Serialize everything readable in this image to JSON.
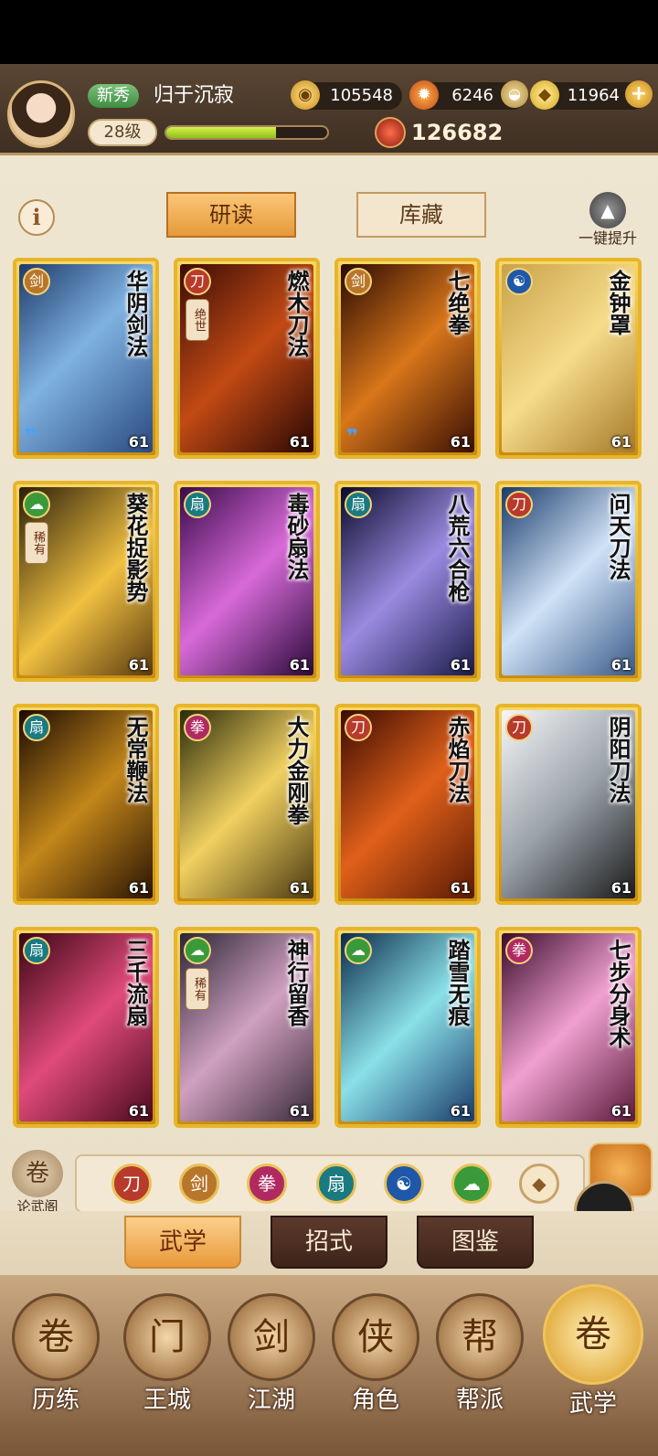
{
  "player": {
    "rank_badge": "新秀",
    "name": "归于沉寂",
    "level": "28级",
    "exp_fraction": 0.68,
    "power": "126682"
  },
  "resources": {
    "coins": "105548",
    "energy": "6246",
    "ingots": "11964"
  },
  "tabs": {
    "study": "研读",
    "storage": "库藏"
  },
  "upgrade_all_label": "一键提升",
  "cards": [
    {
      "title": "华阴剑法",
      "school": "sword",
      "level": "61",
      "tag": ""
    },
    {
      "title": "燃木刀法",
      "school": "blade",
      "level": "61",
      "tag": "绝世"
    },
    {
      "title": "七绝拳",
      "school": "sword",
      "level": "61",
      "tag": ""
    },
    {
      "title": "金钟罩",
      "school": "internal",
      "level": "61",
      "tag": ""
    },
    {
      "title": "葵花捉影势",
      "school": "light",
      "level": "61",
      "tag": "稀有"
    },
    {
      "title": "毒砂扇法",
      "school": "fan",
      "level": "61",
      "tag": ""
    },
    {
      "title": "八荒六合枪",
      "school": "fan",
      "level": "61",
      "tag": ""
    },
    {
      "title": "问天刀法",
      "school": "blade",
      "level": "61",
      "tag": ""
    },
    {
      "title": "无常鞭法",
      "school": "fan",
      "level": "61",
      "tag": ""
    },
    {
      "title": "大力金刚拳",
      "school": "fist",
      "level": "61",
      "tag": ""
    },
    {
      "title": "赤焰刀法",
      "school": "blade",
      "level": "61",
      "tag": ""
    },
    {
      "title": "阴阳刀法",
      "school": "blade",
      "level": "61",
      "tag": ""
    },
    {
      "title": "三千流扇",
      "school": "fan",
      "level": "61",
      "tag": ""
    },
    {
      "title": "神行留香",
      "school": "light",
      "level": "61",
      "tag": "稀有"
    },
    {
      "title": "踏雪无痕",
      "school": "light",
      "level": "61",
      "tag": ""
    },
    {
      "title": "七步分身术",
      "school": "fist",
      "level": "61",
      "tag": ""
    }
  ],
  "hall_label": "论武阁",
  "filters": [
    "blade",
    "sword",
    "fist",
    "fan",
    "internal",
    "light",
    "other"
  ],
  "subtabs": {
    "martial": "武学",
    "moves": "招式",
    "atlas": "图鉴"
  },
  "nav": {
    "training": "历练",
    "city": "王城",
    "jianghu": "江湖",
    "role": "角色",
    "guild": "帮派",
    "martial": "武学"
  },
  "colors": {
    "accent_gold": "#e8b52a",
    "tab_orange": "#e69a3a",
    "exp_green": "#8fbf1a"
  }
}
